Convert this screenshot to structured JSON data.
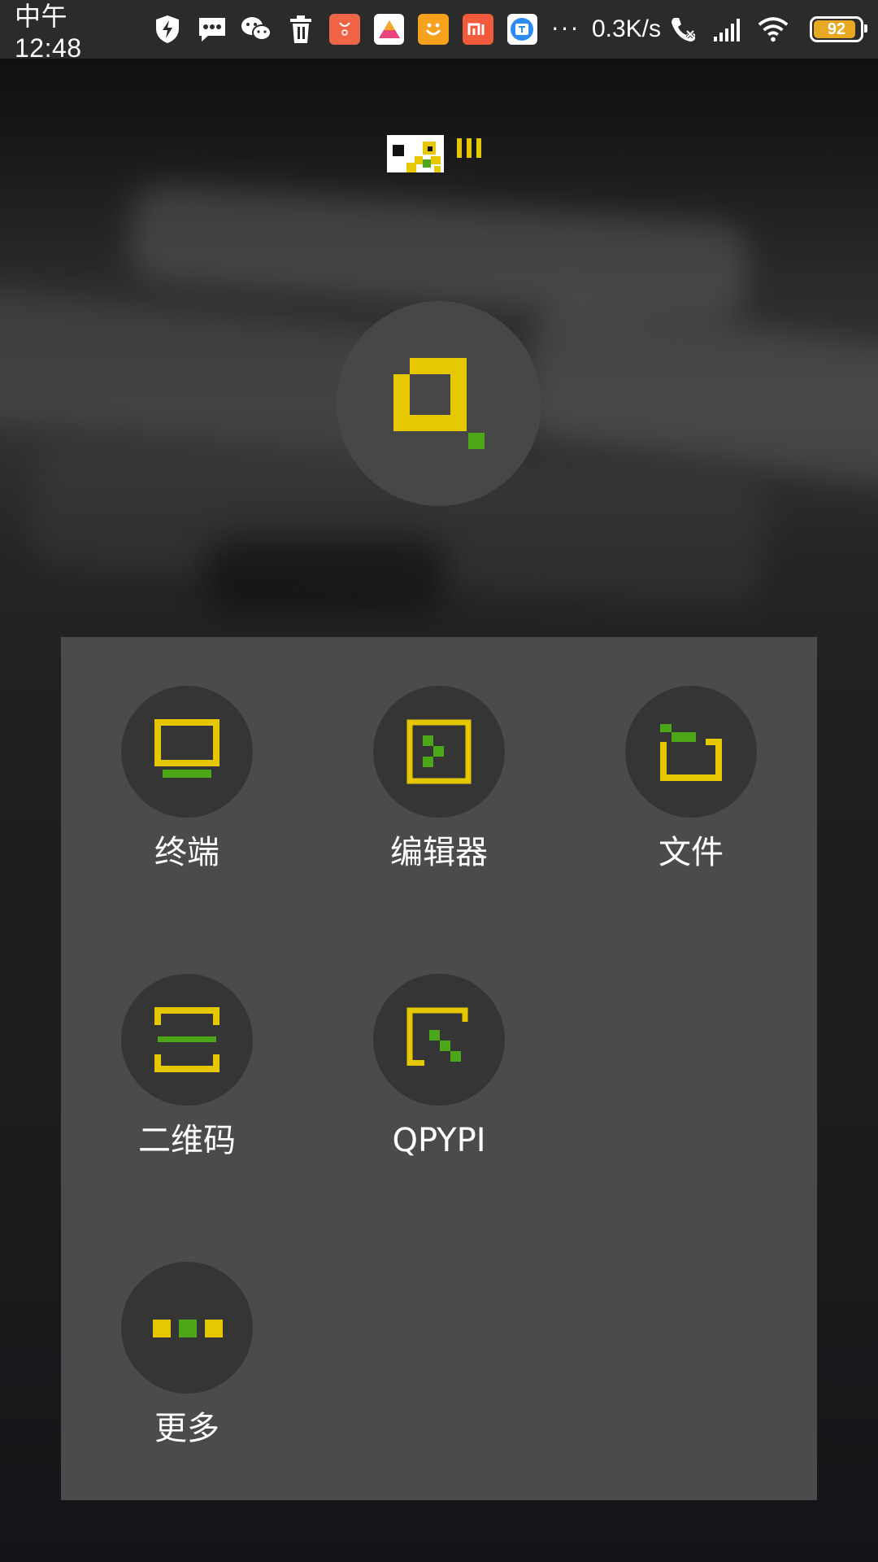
{
  "status_bar": {
    "time": "中午12:48",
    "network_speed": "0.3K/s",
    "battery_level": "92",
    "battery_fraction": 0.92,
    "notification_icons": [
      "shield-icon",
      "message-icon",
      "wechat-icon",
      "trash-icon",
      "shop-app-icon",
      "photo-app-icon",
      "smile-app-icon",
      "mi-app-icon",
      "translate-app-icon"
    ],
    "overflow_indicator": "···"
  },
  "app": {
    "logo_icon": "qpython-logo-icon",
    "hero_icon": "qpython-run-icon",
    "colors": {
      "accent_yellow": "#e5c800",
      "accent_green": "#4ca818",
      "panel": "#4b4b4b",
      "icon_circle": "#353535"
    }
  },
  "menu": {
    "items": [
      {
        "label": "终端",
        "icon": "terminal-icon"
      },
      {
        "label": "编辑器",
        "icon": "editor-icon"
      },
      {
        "label": "文件",
        "icon": "folder-icon"
      },
      {
        "label": "二维码",
        "icon": "qrcode-scan-icon"
      },
      {
        "label": "QPYPI",
        "icon": "qpypi-icon"
      },
      {
        "label": "更多",
        "icon": "more-icon"
      }
    ]
  }
}
